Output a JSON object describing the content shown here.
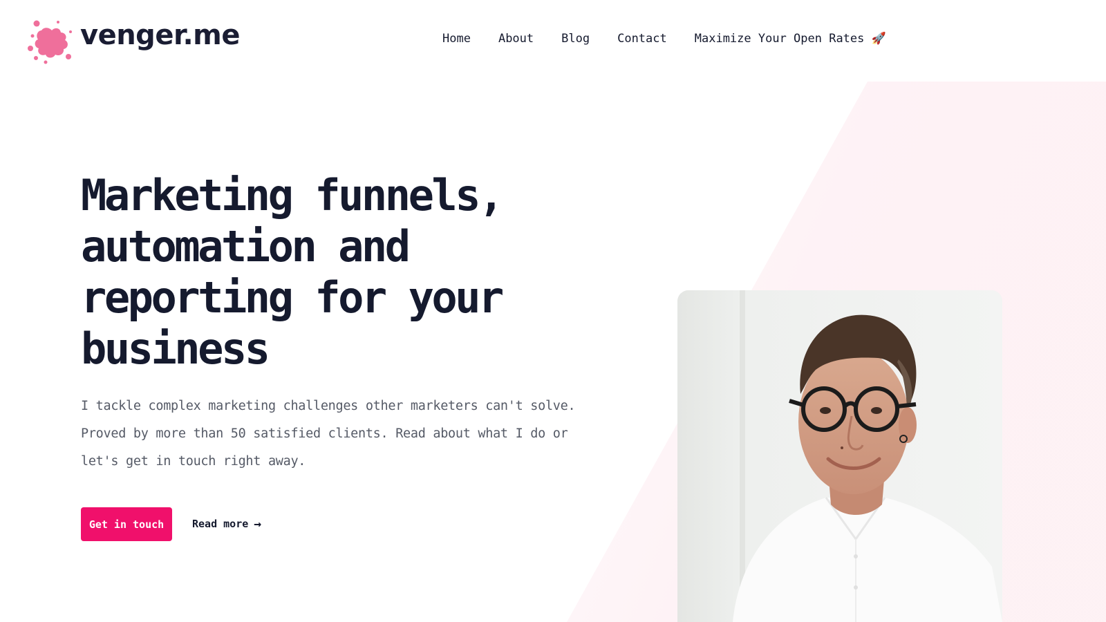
{
  "site": {
    "logo_text": "venger.me",
    "logo_icon": "pink-paint-splash-icon",
    "accent_color": "#f0106b"
  },
  "nav": {
    "items": [
      {
        "label": "Home"
      },
      {
        "label": "About"
      },
      {
        "label": "Blog"
      },
      {
        "label": "Contact"
      },
      {
        "label": "Maximize Your Open Rates 🚀"
      }
    ]
  },
  "hero": {
    "title": "Marketing funnels, automation and reporting for your business",
    "description": "I tackle complex marketing challenges other marketers can't solve. Proved by more than 50 satisfied clients. Read about what I do or let's get in touch right away.",
    "cta_label": "Get in touch",
    "read_more_label": "Read more",
    "read_more_icon": "arrow-right-icon"
  }
}
